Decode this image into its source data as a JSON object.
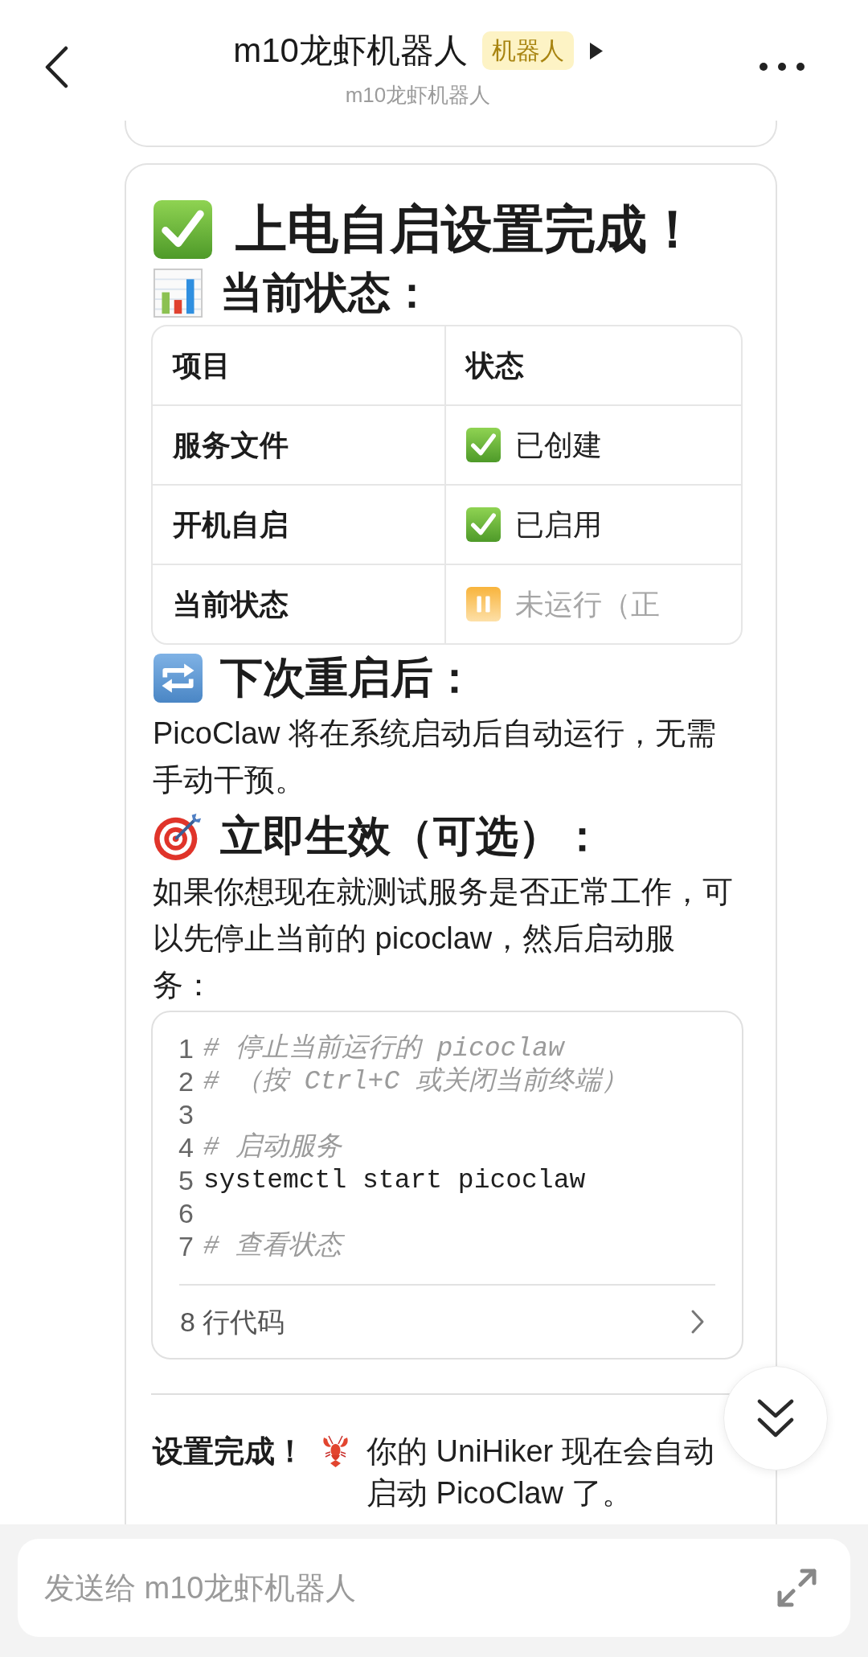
{
  "header": {
    "title": "m10龙虾机器人",
    "badge": "机器人",
    "subtitle": "m10龙虾机器人"
  },
  "message": {
    "blocks": [
      {
        "kind": "title",
        "text": "上电自启设置完成！"
      },
      {
        "kind": "heading",
        "text": "当前状态："
      },
      {
        "kind": "table",
        "columns": [
          "项目",
          "状态"
        ],
        "rows": [
          {
            "item": "服务文件",
            "status": "已创建",
            "kind": "done"
          },
          {
            "item": "开机自启",
            "status": "已启用",
            "kind": "done"
          },
          {
            "item": "当前状态",
            "status": "未运行（正",
            "kind": "paused"
          }
        ]
      },
      {
        "kind": "heading",
        "text": "下次重启后："
      },
      {
        "kind": "paragraph",
        "text": "PicoClaw 将在系统启动后自动运行，无需手动干预。"
      },
      {
        "kind": "heading",
        "text": "立即生效（可选）："
      },
      {
        "kind": "paragraph",
        "text": "如果你想现在就测试服务是否正常工作，可以先停止当前的 picoclaw，然后启动服务："
      },
      {
        "kind": "code",
        "lines": [
          {
            "number": "1",
            "kind": "comment",
            "text": "# 停止当前运行的 picoclaw"
          },
          {
            "number": "2",
            "kind": "comment",
            "text": "# （按 Ctrl+C 或关闭当前终端）"
          },
          {
            "number": "3",
            "kind": "blank"
          },
          {
            "number": "4",
            "kind": "comment",
            "text": "# 启动服务"
          },
          {
            "number": "5",
            "kind": "command",
            "text": "systemctl start picoclaw"
          },
          {
            "number": "6",
            "kind": "blank"
          },
          {
            "number": "7",
            "kind": "comment",
            "text": "# 查看状态"
          }
        ],
        "footer": "8 行代码"
      },
      {
        "kind": "rule"
      },
      {
        "kind": "closing",
        "lead": "设置完成！",
        "text": "你的 UniHiker 现在会自动启动 PicoClaw 了。"
      }
    ]
  },
  "composer": {
    "placeholder": "发送给 m10龙虾机器人"
  }
}
